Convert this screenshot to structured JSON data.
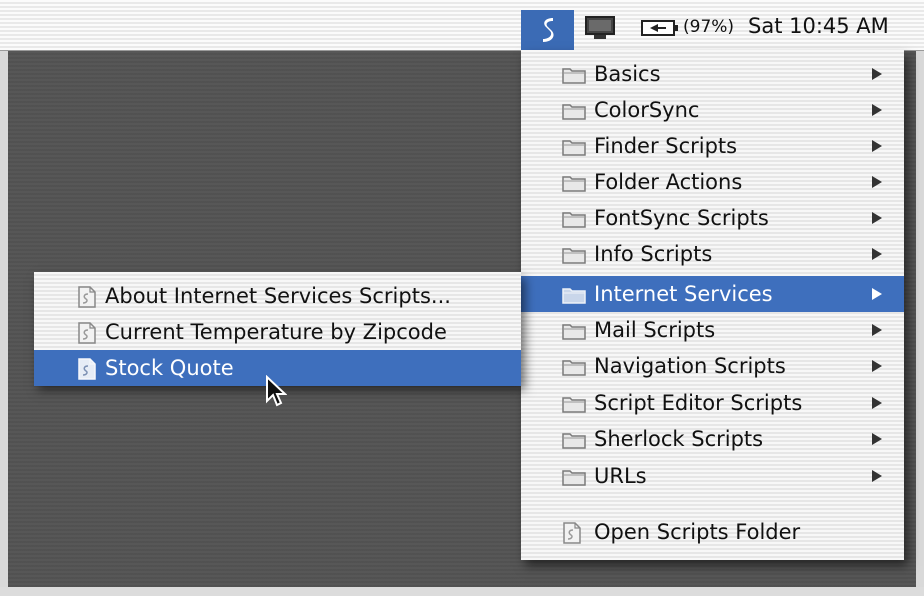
{
  "menubar": {
    "battery_percent": "(97%)",
    "clock": "Sat 10:45 AM"
  },
  "main_menu": {
    "items": [
      {
        "label": "Basics",
        "has_submenu": true
      },
      {
        "label": "ColorSync",
        "has_submenu": true
      },
      {
        "label": "Finder Scripts",
        "has_submenu": true
      },
      {
        "label": "Folder Actions",
        "has_submenu": true
      },
      {
        "label": "FontSync Scripts",
        "has_submenu": true
      },
      {
        "label": "Info Scripts",
        "has_submenu": true
      },
      {
        "label": "Internet Services",
        "has_submenu": true,
        "selected": true
      },
      {
        "label": "Mail Scripts",
        "has_submenu": true
      },
      {
        "label": "Navigation Scripts",
        "has_submenu": true
      },
      {
        "label": "Script Editor Scripts",
        "has_submenu": true
      },
      {
        "label": "Sherlock Scripts",
        "has_submenu": true
      },
      {
        "label": "URLs",
        "has_submenu": true
      }
    ],
    "footer_item": "Open Scripts Folder"
  },
  "sub_menu": {
    "items": [
      {
        "label": "About Internet Services Scripts..."
      },
      {
        "label": "Current Temperature by Zipcode"
      },
      {
        "label": "Stock Quote",
        "selected": true
      }
    ]
  },
  "colors": {
    "highlight": "#3e6fbd",
    "desktop": "#545454"
  }
}
